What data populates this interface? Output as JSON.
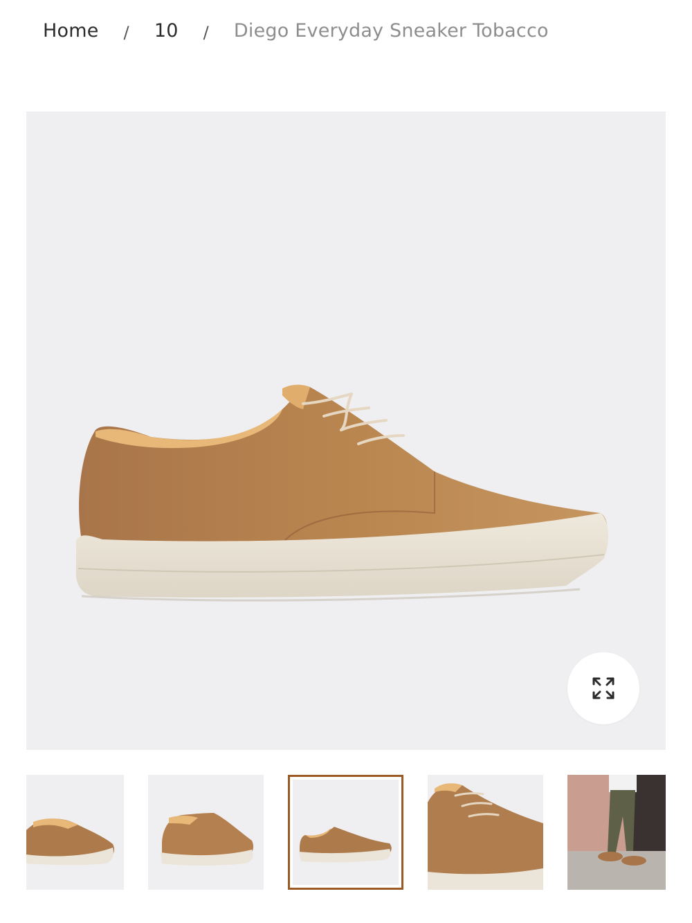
{
  "breadcrumb": {
    "items": [
      {
        "label": "Home"
      },
      {
        "label": "10"
      }
    ],
    "separator": "/",
    "current": "Diego Everyday Sneaker Tobacco"
  },
  "gallery": {
    "main_image": {
      "alt": "Diego Everyday Sneaker Tobacco side view"
    },
    "expand_icon": "expand-arrows-icon",
    "selected_index": 2,
    "thumbnails": [
      {
        "alt": "rear three-quarter view"
      },
      {
        "alt": "front three-quarter view"
      },
      {
        "alt": "side view"
      },
      {
        "alt": "close-up of laces"
      },
      {
        "alt": "lifestyle on-foot photo"
      }
    ]
  },
  "colors": {
    "background": "#ffffff",
    "image_bg": "#efeff1",
    "leather": "#ad7a4c",
    "sole": "#e8e2d6",
    "selected_border": "#9b5a24",
    "breadcrumb_current": "#8d8d8d"
  }
}
